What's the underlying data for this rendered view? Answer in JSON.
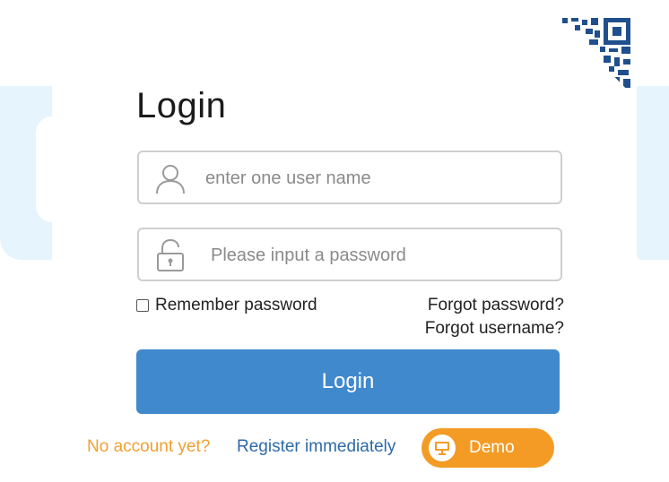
{
  "login": {
    "title": "Login",
    "username_placeholder": "enter one user name",
    "password_placeholder": "Please input a password",
    "remember_label": "Remember password",
    "forgot_password": "Forgot password?",
    "forgot_username": "Forgot username?",
    "login_button": "Login"
  },
  "footer": {
    "no_account": "No account yet?",
    "register": "Register immediately",
    "demo": "Demo"
  },
  "icons": {
    "user": "user-icon",
    "lock": "lock-icon",
    "qr": "qr-code-icon",
    "demo": "presentation-icon"
  },
  "colors": {
    "primary": "#4089cd",
    "accent_orange": "#f39b25",
    "link_blue": "#2e6aa8",
    "hint_orange": "#f0a030",
    "panel_bg": "#e6f4fd"
  }
}
